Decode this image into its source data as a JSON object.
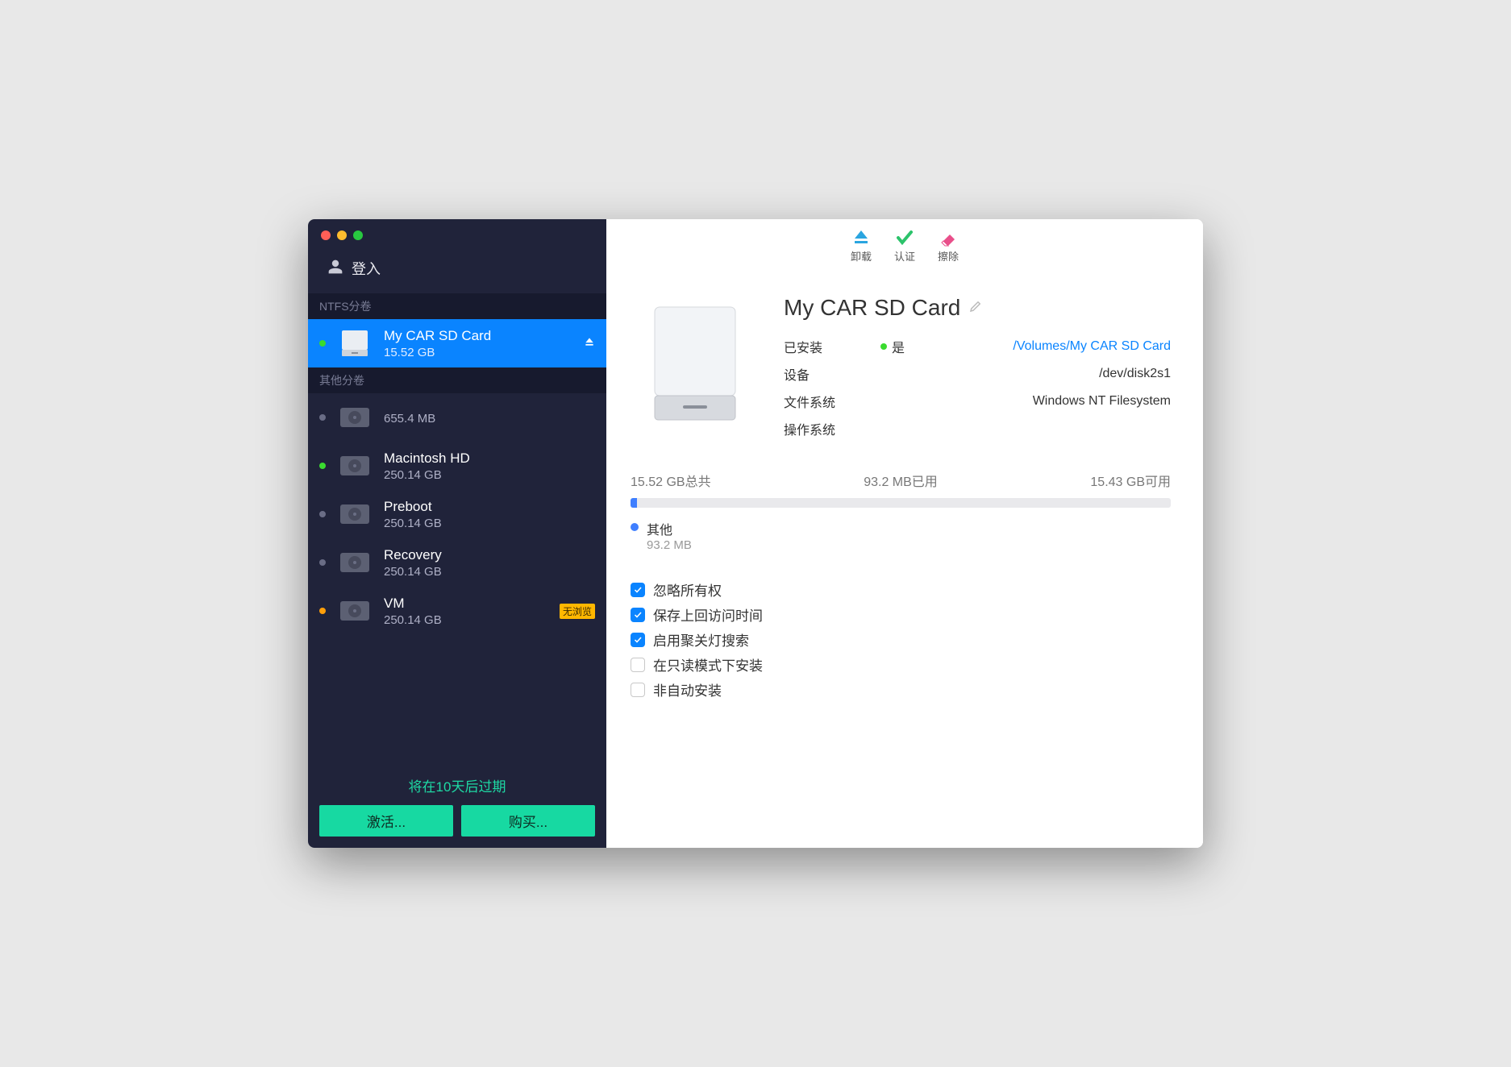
{
  "sidebar": {
    "login_label": "登入",
    "ntfs_header": "NTFS分卷",
    "other_header": "其他分卷",
    "trial_text": "将在10天后过期",
    "activate_label": "激活...",
    "buy_label": "购买...",
    "volumes": {
      "ntfs": [
        {
          "name": "My CAR SD Card",
          "size": "15.52 GB",
          "status": "green",
          "selected": true
        }
      ],
      "other": [
        {
          "name": "",
          "size": "655.4 MB",
          "status": "grey"
        },
        {
          "name": "Macintosh HD",
          "size": "250.14 GB",
          "status": "green"
        },
        {
          "name": "Preboot",
          "size": "250.14 GB",
          "status": "grey"
        },
        {
          "name": "Recovery",
          "size": "250.14 GB",
          "status": "grey"
        },
        {
          "name": "VM",
          "size": "250.14 GB",
          "status": "orange",
          "badge": "无浏览"
        }
      ]
    }
  },
  "toolbar": {
    "unmount": "卸载",
    "verify": "认证",
    "erase": "擦除"
  },
  "main": {
    "volume_title": "My CAR SD Card",
    "info": {
      "mounted_label": "已安装",
      "mounted_value": "是",
      "mounted_path": "/Volumes/My CAR SD Card",
      "device_label": "设备",
      "device_value": "/dev/disk2s1",
      "fs_label": "文件系统",
      "fs_value": "Windows NT Filesystem",
      "os_label": "操作系统",
      "os_value": ""
    },
    "space": {
      "total": "15.52 GB总共",
      "used": "93.2 MB已用",
      "free": "15.43 GB可用",
      "category_name": "其他",
      "category_size": "93.2 MB"
    },
    "checks": [
      {
        "label": "忽略所有权",
        "checked": true
      },
      {
        "label": "保存上回访问时间",
        "checked": true
      },
      {
        "label": "启用聚关灯搜索",
        "checked": true
      },
      {
        "label": "在只读模式下安装",
        "checked": false
      },
      {
        "label": "非自动安装",
        "checked": false
      }
    ]
  }
}
